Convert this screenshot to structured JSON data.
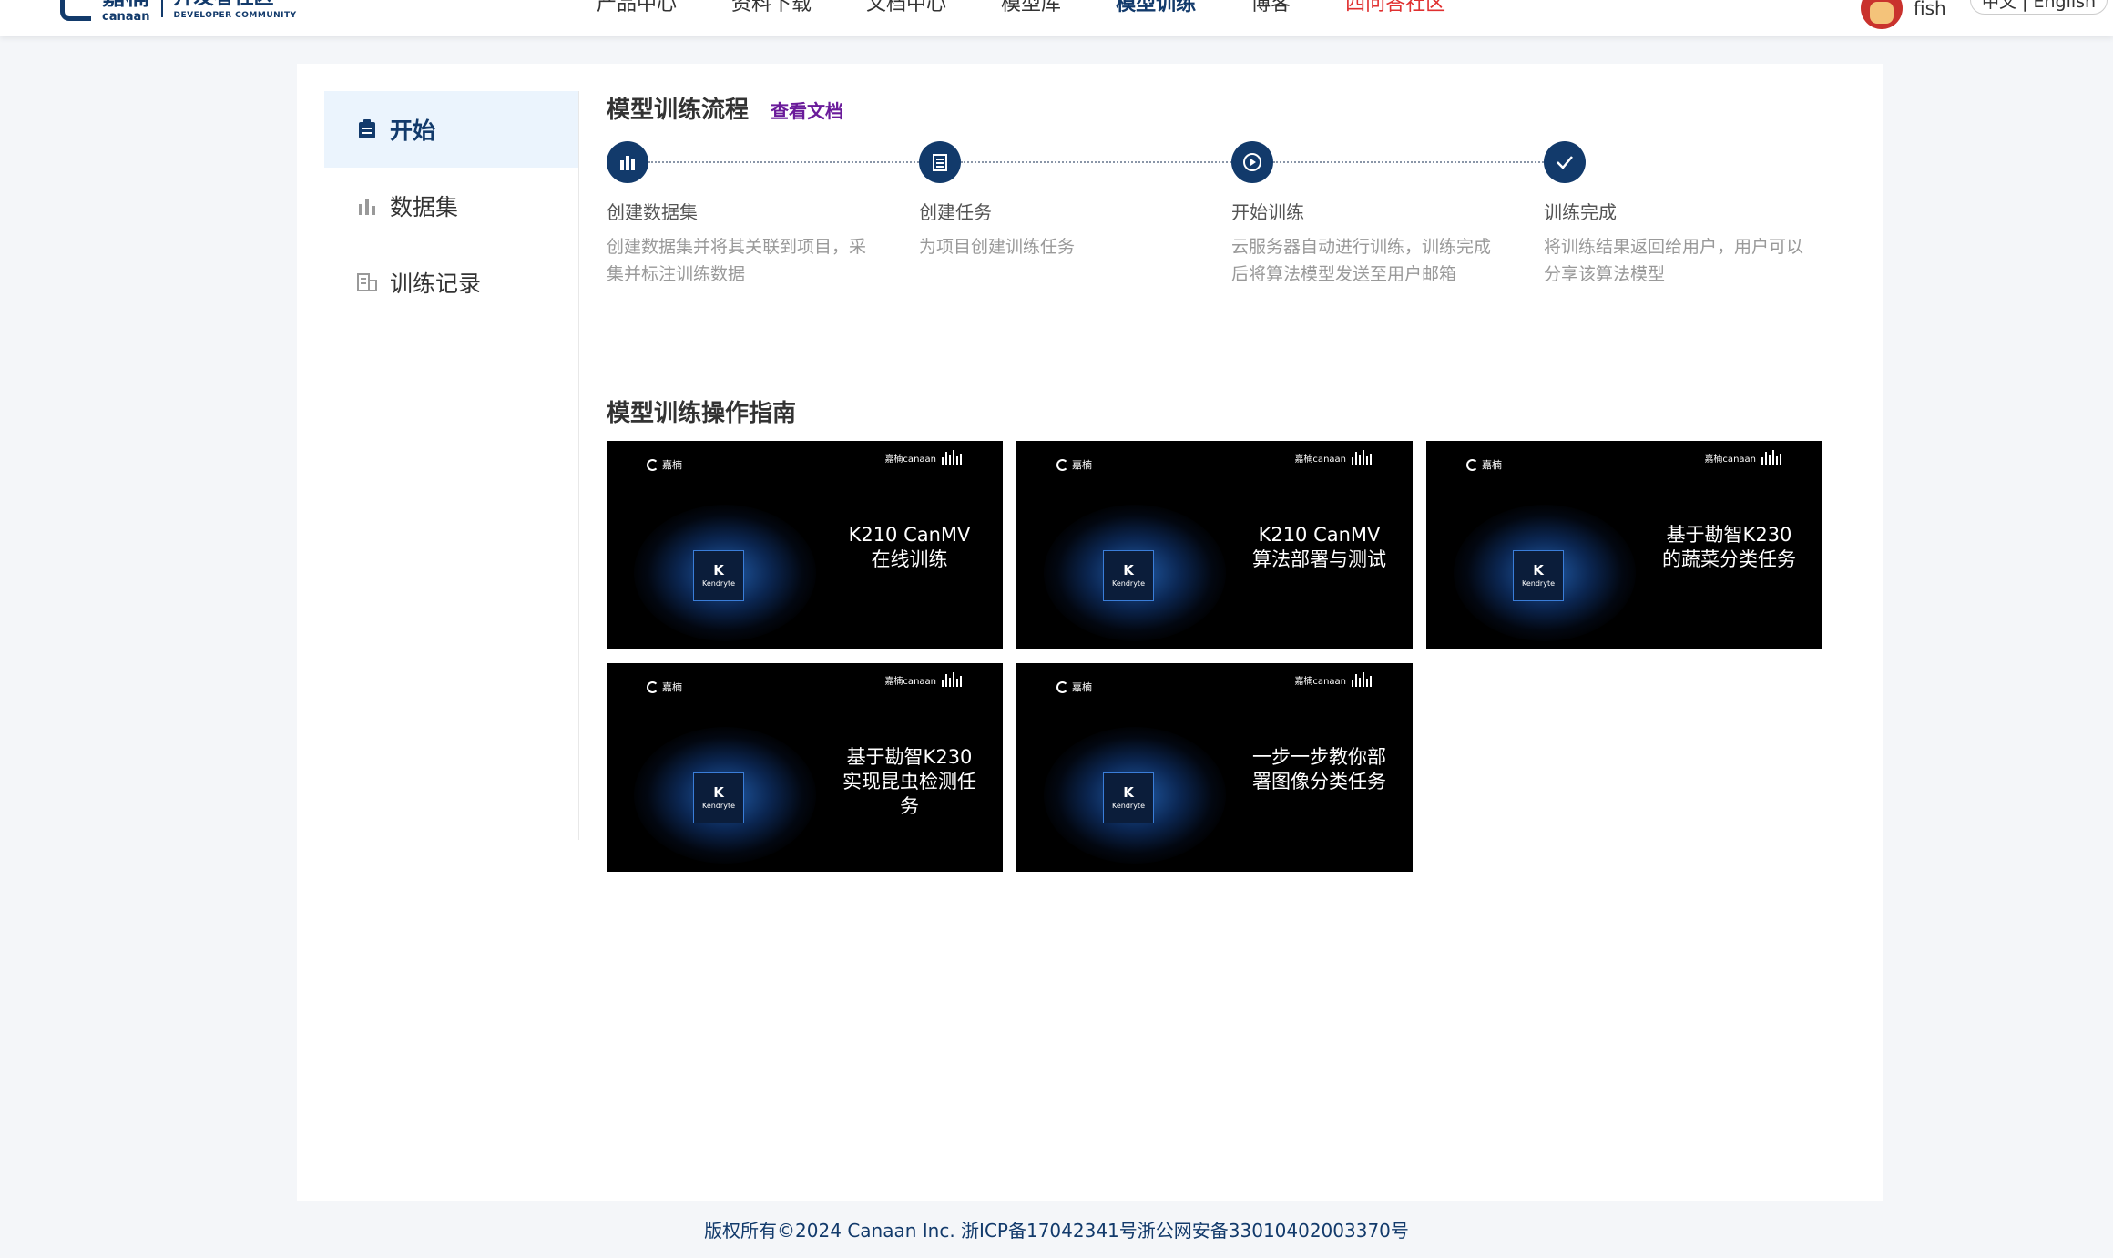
{
  "header": {
    "logo": {
      "brand_cn": "嘉楠",
      "brand_en": "canaan",
      "dev_cn": "开发者社区",
      "dev_en": "DEVELOPER COMMUNITY"
    },
    "nav": [
      {
        "label": "产品中心"
      },
      {
        "label": "资料下载"
      },
      {
        "label": "文档中心"
      },
      {
        "label": "模型库"
      },
      {
        "label": "模型训练",
        "active": true
      },
      {
        "label": "博客"
      },
      {
        "label": "四问答社区",
        "color": "#e03030"
      }
    ],
    "user": {
      "name": "fish"
    },
    "lang": "中文 | English"
  },
  "sidebar": {
    "items": [
      {
        "label": "开始",
        "icon": "clipboard-icon",
        "active": true
      },
      {
        "label": "数据集",
        "icon": "bar-chart-icon"
      },
      {
        "label": "训练记录",
        "icon": "building-icon"
      }
    ]
  },
  "flow": {
    "title": "模型训练流程",
    "doc_link": "查看文档",
    "steps": [
      {
        "title": "创建数据集",
        "desc": "创建数据集并将其关联到项目，采集并标注训练数据",
        "icon": "bar-chart-icon"
      },
      {
        "title": "创建任务",
        "desc": "为项目创建训练任务",
        "icon": "document-icon"
      },
      {
        "title": "开始训练",
        "desc": "云服务器自动进行训练，训练完成后将算法模型发送至用户邮箱",
        "icon": "play-icon"
      },
      {
        "title": "训练完成",
        "desc": "将训练结果返回给用户，用户可以分享该算法模型",
        "icon": "check-icon"
      }
    ]
  },
  "guide": {
    "title": "模型训练操作指南",
    "brand_left": "嘉楠",
    "brand_right": "嘉楠canaan",
    "chip_label": "Kendryte",
    "videos": [
      {
        "title_lines": [
          "K210 CanMV",
          "在线训练"
        ]
      },
      {
        "title_lines": [
          "K210 CanMV",
          "算法部署与测试"
        ]
      },
      {
        "title_lines": [
          "基于勘智K230",
          "的蔬菜分类任务"
        ]
      },
      {
        "title_lines": [
          "基于勘智K230",
          "实现昆虫检测任",
          "务"
        ]
      },
      {
        "title_lines": [
          "一步一步教你部",
          "署图像分类任务"
        ]
      }
    ]
  },
  "footer": {
    "text": "版权所有©2024 Canaan Inc. 浙ICP备17042341号浙公网安备33010402003370号"
  },
  "colors": {
    "primary": "#123a6b",
    "accent_link": "#6a1b9a",
    "sidebar_active_bg": "#ebf4fd",
    "alert": "#e03030"
  }
}
